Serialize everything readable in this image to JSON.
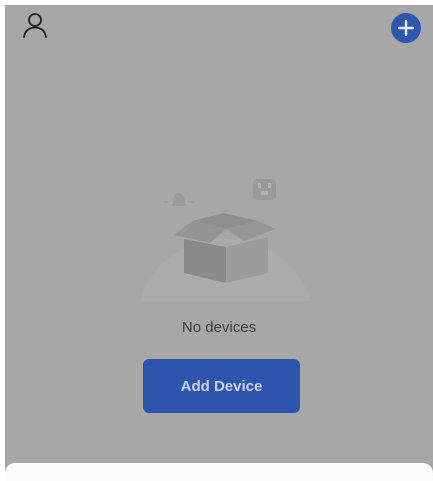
{
  "header": {
    "profile_icon": "person-icon",
    "add_icon": "plus-circle-icon"
  },
  "empty_state": {
    "illustration": "empty-box-illustration",
    "message": "No devices",
    "add_device_label": "Add Device"
  },
  "colors": {
    "overlay_background": "#a7a7a7",
    "accent": "#2e55ae",
    "bottom_sheet": "#fbfbfb"
  }
}
